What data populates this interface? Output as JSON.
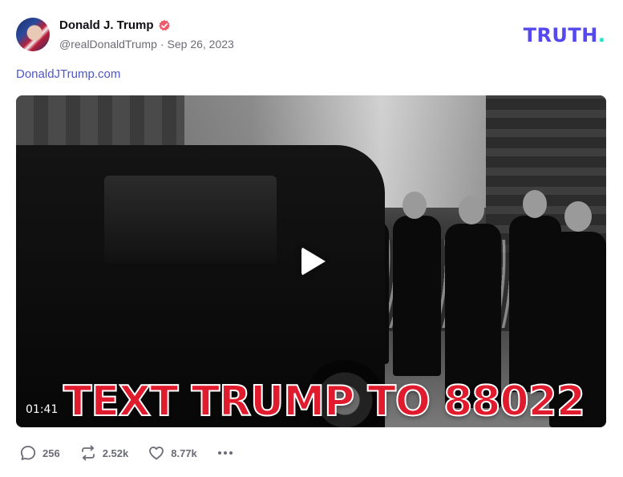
{
  "author": {
    "name": "Donald J. Trump",
    "handle": "@realDonaldTrump",
    "separator": "·",
    "date": "Sep 26, 2023"
  },
  "brand": {
    "wordmark": "TRUTH",
    "dot": ".",
    "wordmark_color": "#5448EE",
    "dot_color": "#17E6C4"
  },
  "post": {
    "link_text": "DonaldJTrump.com"
  },
  "video": {
    "caption": "TEXT TRUMP TO 88022",
    "duration": "01:41",
    "caption_color": "#E01B2D"
  },
  "actions": {
    "replies": "256",
    "retruths": "2.52k",
    "likes": "8.77k"
  },
  "colors": {
    "verified": "#F05A6B",
    "link": "#4D57C9",
    "muted": "#6B6B76"
  },
  "icons": [
    "verified-badge-icon",
    "play-icon",
    "reply-icon",
    "retruth-icon",
    "like-icon",
    "more-icon"
  ]
}
